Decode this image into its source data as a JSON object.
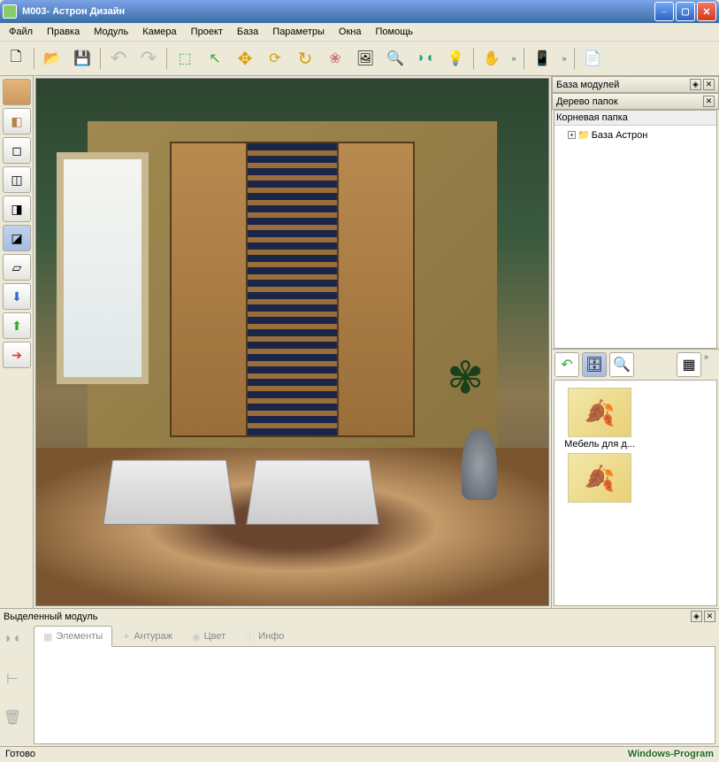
{
  "title": "М003- Астрон Дизайн",
  "menu": [
    "Файл",
    "Правка",
    "Модуль",
    "Камера",
    "Проект",
    "База",
    "Параметры",
    "Окна",
    "Помощь"
  ],
  "toolbar_icons": {
    "new": "🗋",
    "open": "📂",
    "save": "💾",
    "undo": "↶",
    "redo": "↷",
    "select_rect": "⬚",
    "select_cursor": "↖",
    "move": "✥",
    "rotate90": "⟳",
    "rotate": "↻",
    "flower": "❀",
    "image": "🖼",
    "search": "🔍",
    "flip": "◗◖",
    "bulb": "💡",
    "hand": "✋",
    "phone": "📱",
    "doc": "📄"
  },
  "left_icons": [
    "▬",
    "◧",
    "◻",
    "◫",
    "◨",
    "◪",
    "▱",
    "⬇",
    "⬆",
    "➔"
  ],
  "right": {
    "panel1_title": "База модулей",
    "panel2_title": "Дерево папок",
    "root": "Корневая папка",
    "tree_item": "База Астрон",
    "thumb1": "Мебель для д..."
  },
  "bottom": {
    "title": "Выделенный модуль",
    "tabs": [
      "Элементы",
      "Антураж",
      "Цвет",
      "Инфо"
    ]
  },
  "status": "Готово",
  "watermark": "Windows-Program"
}
